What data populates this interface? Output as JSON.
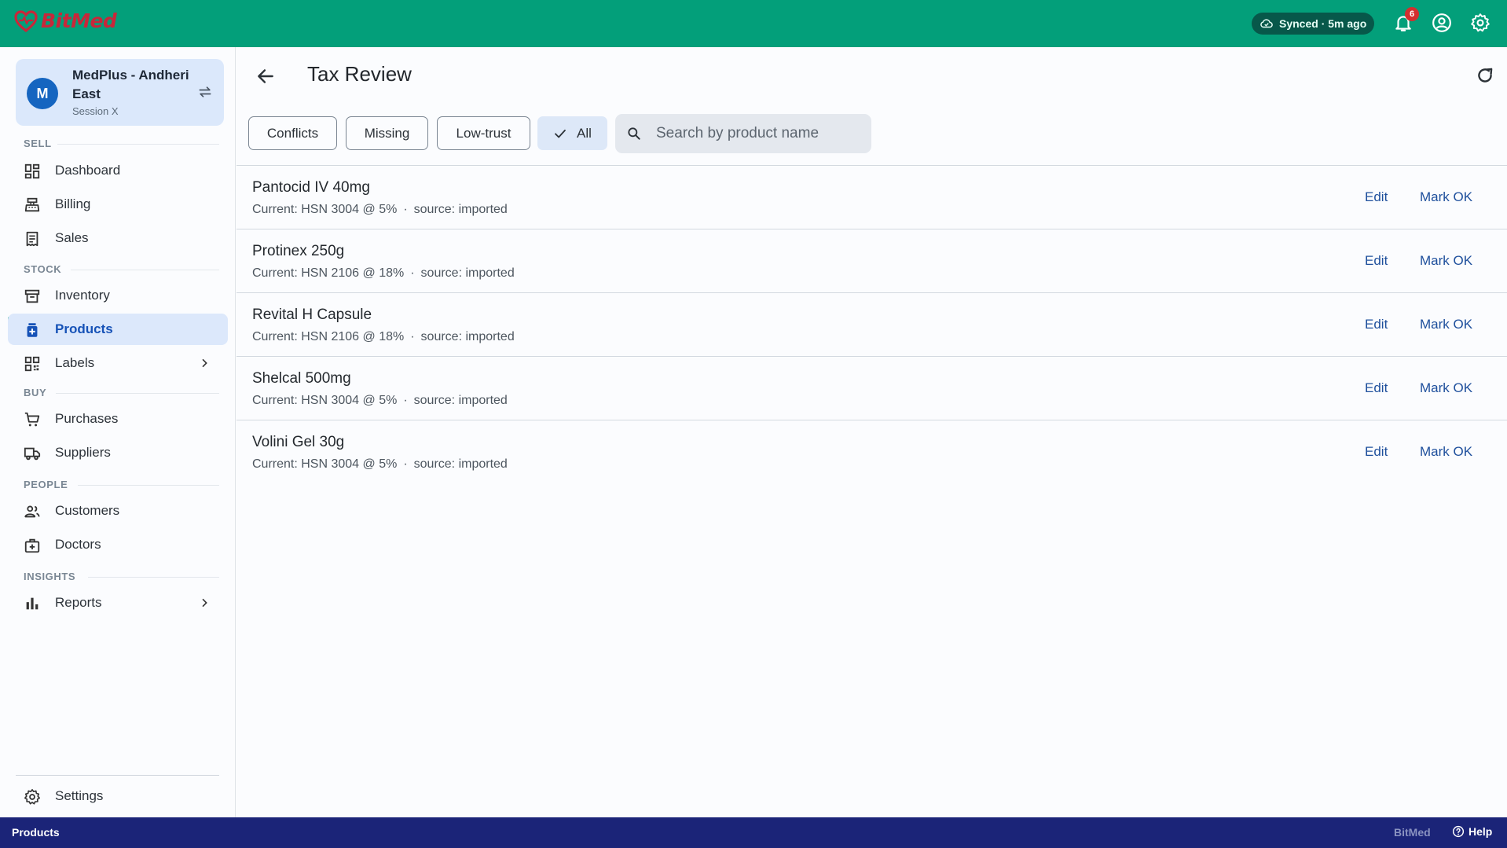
{
  "app": {
    "brand": "BitMed"
  },
  "topbar": {
    "sync_status": "Synced · 5m ago",
    "notification_count": "6",
    "icons": [
      "cloud-check-icon",
      "bell-icon",
      "account-circle-icon",
      "gear-icon"
    ]
  },
  "store": {
    "avatar_letter": "M",
    "name": "MedPlus - Andheri East",
    "session": "Session X"
  },
  "sidebar": {
    "sections": {
      "sell": "SELL",
      "stock": "STOCK",
      "buy": "BUY",
      "people": "PEOPLE",
      "insights": "INSIGHTS"
    },
    "items": {
      "dashboard": "Dashboard",
      "billing": "Billing",
      "sales": "Sales",
      "inventory": "Inventory",
      "products": "Products",
      "labels": "Labels",
      "purchases": "Purchases",
      "suppliers": "Suppliers",
      "customers": "Customers",
      "doctors": "Doctors",
      "reports": "Reports",
      "settings": "Settings"
    },
    "active_item": "Products"
  },
  "page": {
    "title": "Tax Review"
  },
  "filters": {
    "chips": [
      "Conflicts",
      "Missing",
      "Low-trust",
      "All"
    ],
    "selected": "All",
    "search_placeholder": "Search by product name"
  },
  "rows": [
    {
      "name": "Pantocid IV 40mg",
      "current": "Current: HSN 3004 @ 5%",
      "source": "source: imported",
      "edit": "Edit",
      "mark_ok": "Mark OK"
    },
    {
      "name": "Protinex 250g",
      "current": "Current: HSN 2106 @ 18%",
      "source": "source: imported",
      "edit": "Edit",
      "mark_ok": "Mark OK"
    },
    {
      "name": "Revital H Capsule",
      "current": "Current: HSN 2106 @ 18%",
      "source": "source: imported",
      "edit": "Edit",
      "mark_ok": "Mark OK"
    },
    {
      "name": "Shelcal 500mg",
      "current": "Current: HSN 3004 @ 5%",
      "source": "source: imported",
      "edit": "Edit",
      "mark_ok": "Mark OK"
    },
    {
      "name": "Volini Gel 30g",
      "current": "Current: HSN 3004 @ 5%",
      "source": "source: imported",
      "edit": "Edit",
      "mark_ok": "Mark OK"
    }
  ],
  "statusbar": {
    "left": "Products",
    "brand": "BitMed",
    "help": "Help"
  },
  "colors": {
    "topbar": "#039f7a",
    "accent_blue": "#1652b7",
    "statusbar": "#1b2478",
    "brand_red": "#c8273a"
  }
}
